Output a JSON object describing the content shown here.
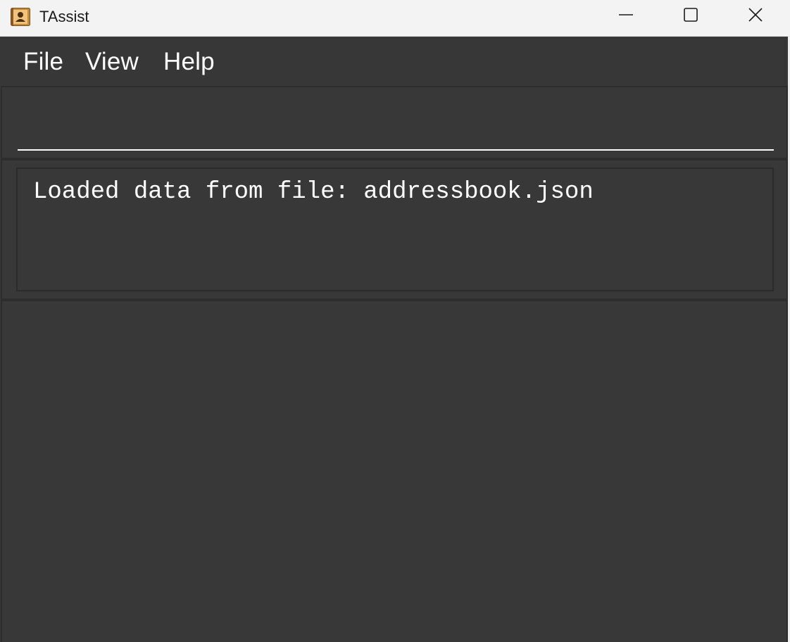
{
  "window": {
    "title": "TAssist",
    "app_icon": "address-book-icon",
    "controls": {
      "minimize_icon": "minimize-icon",
      "maximize_icon": "maximize-icon",
      "close_icon": "close-icon"
    }
  },
  "menu": {
    "items": [
      {
        "label": "File"
      },
      {
        "label": "View"
      },
      {
        "label": "Help"
      }
    ]
  },
  "command_box": {
    "value": "",
    "placeholder": ""
  },
  "result_display": {
    "text": "Loaded data from file: addressbook.json"
  },
  "colors": {
    "titlebar_bg": "#f3f3f3",
    "app_bg": "#383838",
    "text": "#ffffff"
  }
}
